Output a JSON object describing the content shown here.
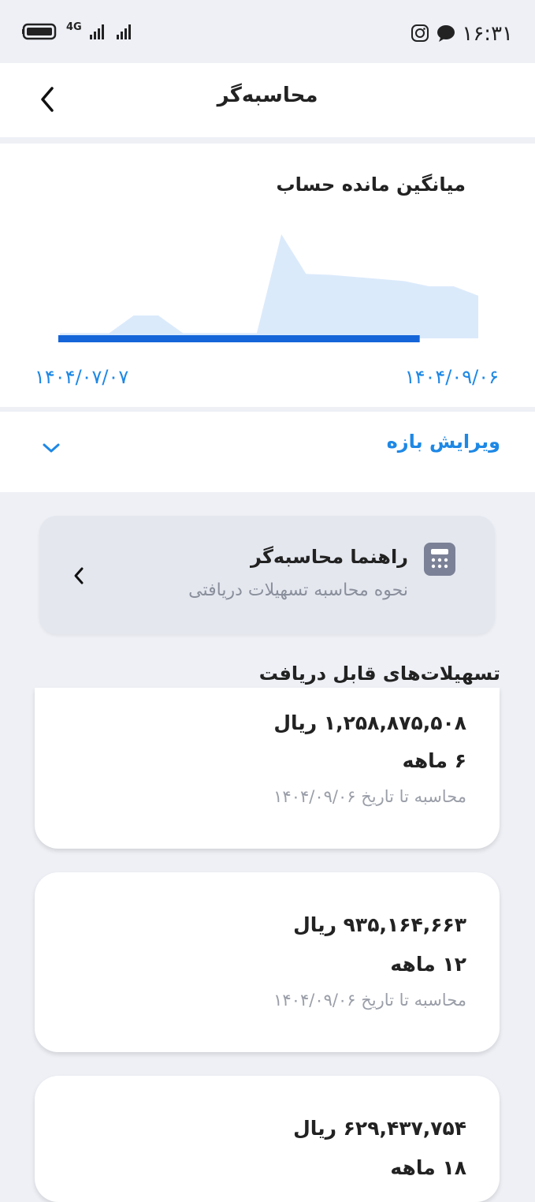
{
  "status_bar": {
    "time": "۱۶:۳۱",
    "network": "4G",
    "icons": [
      "instagram-icon",
      "chat-icon",
      "battery-icon",
      "signal-icon"
    ]
  },
  "header": {
    "title": "محاسبه‌گر",
    "back_icon": "chevron-left-icon"
  },
  "chart_card": {
    "title": "میانگین مانده حساب",
    "start_date": "۱۴۰۴/۰۷/۰۷",
    "end_date": "۱۴۰۴/۰۹/۰۶",
    "chart_data": {
      "type": "area",
      "title": "میانگین مانده حساب",
      "x": [
        "۱۴۰۴/۰۷/۰۷",
        "۱۴۰۴/۰۹/۰۶"
      ],
      "series": [
        {
          "values": [
            0.05,
            0.05,
            0.05,
            0.22,
            0.22,
            0.05,
            0.05,
            0.05,
            0.05,
            1.0,
            0.62,
            0.61,
            0.59,
            0.57,
            0.55,
            0.5,
            0.5,
            0.41
          ]
        }
      ],
      "selected_range_fraction": [
        0.0,
        0.86
      ],
      "colors": {
        "area": "#dbeafb",
        "selection": "#1565d8"
      }
    }
  },
  "edit_range": {
    "label": "ویرایش بازه",
    "icon": "chevron-down-icon"
  },
  "guide": {
    "title": "راهنما محاسبه‌گر",
    "subtitle": "نحوه محاسبه تسهیلات دریافتی",
    "icon": "calculator-icon"
  },
  "section_title": "تسهیلات‌های قابل دریافت",
  "loans": [
    {
      "amount": "۱,۲۵۸,۸۷۵,۵۰۸ ریال",
      "term": "۶ ماهه",
      "date_note": "محاسبه تا تاریخ ۱۴۰۴/۰۹/۰۶"
    },
    {
      "amount": "۹۳۵,۱۶۴,۶۶۳ ریال",
      "term": "۱۲ ماهه",
      "date_note": "محاسبه تا تاریخ ۱۴۰۴/۰۹/۰۶"
    },
    {
      "amount": "۶۲۹,۴۳۷,۷۵۴ ریال",
      "term": "۱۸ ماهه",
      "date_note": ""
    }
  ],
  "colors": {
    "accent": "#1e88e5",
    "background": "#eef0f6",
    "card": "#ffffff"
  }
}
